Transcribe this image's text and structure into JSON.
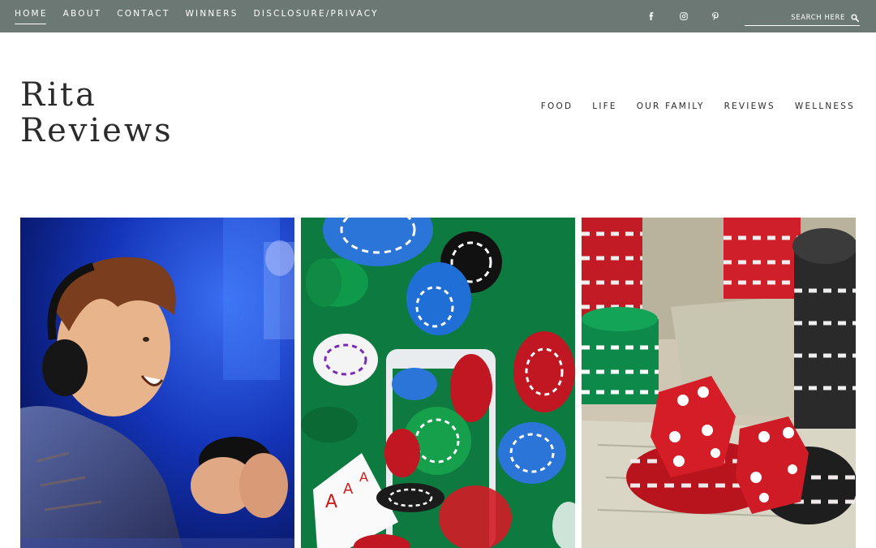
{
  "topbar": {
    "nav": [
      "HOME",
      "ABOUT",
      "CONTACT",
      "WINNERS",
      "DISCLOSURE/PRIVACY"
    ],
    "active": "HOME",
    "social_icons": [
      "facebook-icon",
      "instagram-icon",
      "pinterest-icon"
    ],
    "search_placeholder": "SEARCH HERE",
    "bg_color": "#6b7874"
  },
  "header": {
    "title_line1": "Rita",
    "title_line2": "Reviews",
    "nav": [
      "FOOD",
      "LIFE",
      "OUR FAMILY",
      "REVIEWS",
      "WELLNESS"
    ]
  },
  "featured": [
    {
      "image": "boy-playing-video-games-with-headphones-and-controller"
    },
    {
      "image": "casino-chips-playing-cards-and-smartphone-on-green-felt"
    },
    {
      "image": "red-dice-on-poker-chips-and-dollar-bills"
    }
  ]
}
